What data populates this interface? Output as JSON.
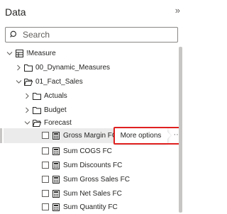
{
  "header": {
    "title": "Data",
    "collapse_icon": "chevron-double-right-icon",
    "collapse_glyph": "»"
  },
  "search": {
    "placeholder": "Search",
    "value": ""
  },
  "tree": {
    "measure_root": "!Measure",
    "dynamic_measures": "00_Dynamic_Measures",
    "fact_sales": "01_Fact_Sales",
    "actuals": "Actuals",
    "budget": "Budget",
    "forecast": "Forecast",
    "measures": [
      "Gross Margin FC",
      "Sum COGS FC",
      "Sum Discounts FC",
      "Sum Gross Sales FC",
      "Sum Net Sales FC",
      "Sum Quantity FC"
    ]
  },
  "tooltip": {
    "label": "More options"
  },
  "more_button": {
    "glyph": "···"
  },
  "colors": {
    "highlight": "#e02020",
    "hover": "#ebebeb",
    "text": "#252423",
    "icon": "#605e5c"
  }
}
